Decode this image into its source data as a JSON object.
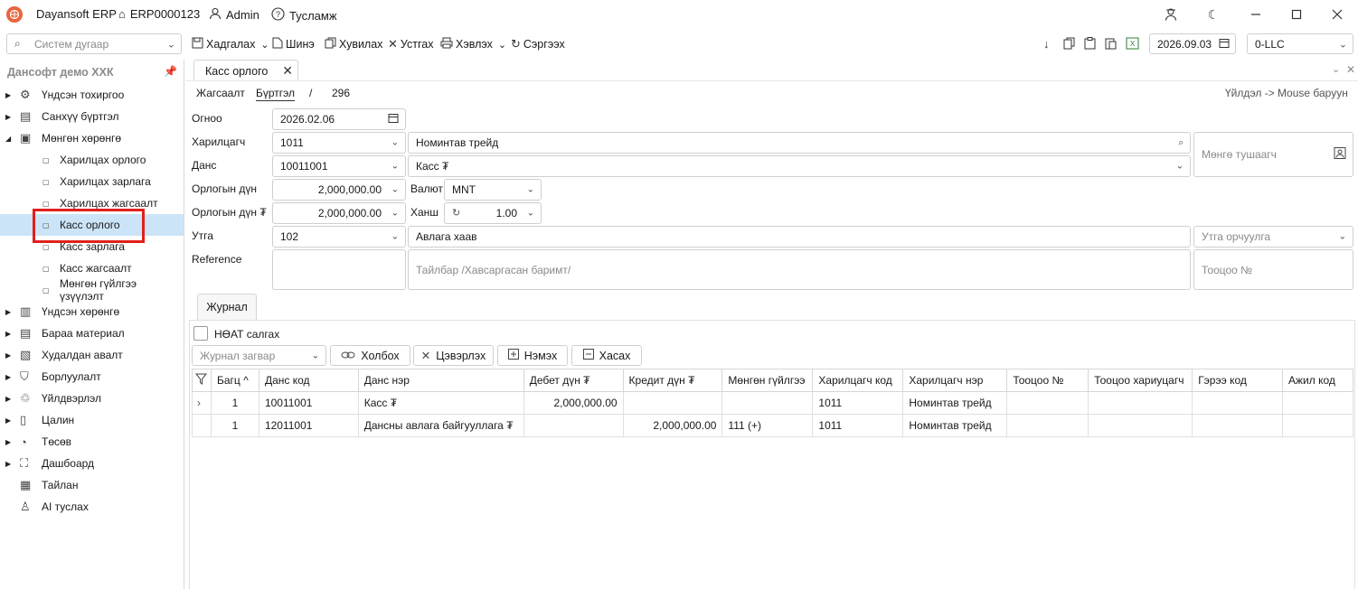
{
  "titlebar": {
    "app_name": "Dayansoft ERP",
    "db_name": "ERP0000123",
    "user": "Admin",
    "help": "Тусламж"
  },
  "toolbar": {
    "system_search_placeholder": "Систем дугаар",
    "save": "Хадгалах",
    "new": "Шинэ",
    "copy": "Хувилах",
    "delete": "Устгах",
    "print": "Хэвлэх",
    "refresh": "Сэргээх",
    "date": "2026.09.03",
    "company": "0-LLC"
  },
  "sidebar": {
    "company": "Дансофт демо ХХК",
    "items": [
      {
        "label": "Үндсэн тохиргоо",
        "icon": "gear-icon"
      },
      {
        "label": "Санхүү бүртгэл",
        "icon": "ledger-icon"
      },
      {
        "label": "Мөнгөн хөрөнгө",
        "icon": "cash-icon"
      },
      {
        "label": "Харилцах орлого",
        "icon": "bullet-icon"
      },
      {
        "label": "Харилцах зарлага",
        "icon": "bullet-icon"
      },
      {
        "label": "Харилцах жагсаалт",
        "icon": "bullet-icon"
      },
      {
        "label": "Касс орлого",
        "icon": "bullet-icon"
      },
      {
        "label": "Касс зарлага",
        "icon": "bullet-icon"
      },
      {
        "label": "Касс жагсаалт",
        "icon": "bullet-icon"
      },
      {
        "label": "Мөнгөн гүйлгээ үзүүлэлт",
        "icon": "bullet-icon"
      },
      {
        "label": "Үндсэн хөрөнгө",
        "icon": "building-icon"
      },
      {
        "label": "Бараа материал",
        "icon": "box-icon"
      },
      {
        "label": "Худалдан авалт",
        "icon": "cart-icon"
      },
      {
        "label": "Борлуулалт",
        "icon": "sales-icon"
      },
      {
        "label": "Үйлдвэрлэл",
        "icon": "factory-icon"
      },
      {
        "label": "Цалин",
        "icon": "payroll-icon"
      },
      {
        "label": "Төсөв",
        "icon": "pie-icon"
      },
      {
        "label": "Дашбоард",
        "icon": "dashboard-icon"
      },
      {
        "label": "Тайлан",
        "icon": "report-icon"
      },
      {
        "label": "AI туслах",
        "icon": "ai-icon"
      }
    ]
  },
  "doc_tab": {
    "label": "Касс орлого"
  },
  "breadcrumb": {
    "list": "Жагсаалт",
    "register": "Бүртгэл",
    "sep": "/",
    "number": "296"
  },
  "hint": "Үйлдэл -> Mouse баруун",
  "form": {
    "date_label": "Огноо",
    "date": "2026.02.06",
    "partner_label": "Харилцагч",
    "partner_code": "1011",
    "partner_name": "Номинтав трейд",
    "cash_receiver": "Мөнгө тушаагч",
    "account_label": "Данс",
    "account_code": "10011001",
    "account_name": "Касс ₮",
    "amount_label": "Орлогын дүн",
    "amount": "2,000,000.00",
    "currency_label": "Валют",
    "currency": "MNT",
    "amount_mnt_label": "Орлогын дүн ₮",
    "amount_mnt": "2,000,000.00",
    "rate_label": "Ханш",
    "rate": "1.00",
    "purpose_label": "Утга",
    "purpose_code": "102",
    "purpose_text": "Авлага хаав",
    "purpose_translate": "Утга орчуулга",
    "reference_label": "Reference",
    "note_placeholder": "Тайлбар /Хавсаргасан баримт/",
    "count_placeholder": "Тооцоо №"
  },
  "journal": {
    "tab": "Журнал",
    "vat_checkbox": "НӨАТ салгах",
    "template_placeholder": "Журнал загвар",
    "link": "Холбох",
    "clear": "Цэвэрлэх",
    "add": "Нэмэх",
    "remove": "Хасах",
    "columns": [
      "Багц",
      "Данс код",
      "Данс нэр",
      "Дебет дүн ₮",
      "Кредит дүн ₮",
      "Мөнгөн гүйлгээ",
      "Харилцагч код",
      "Харилцагч нэр",
      "Тооцоо №",
      "Тооцоо хариуцагч",
      "Гэрээ код",
      "Ажил код"
    ],
    "rows": [
      {
        "pointer": "›",
        "batch": "1",
        "acc_code": "10011001",
        "acc_name": "Касс ₮",
        "debit": "2,000,000.00",
        "credit": "",
        "cashflow": "",
        "partner_code": "1011",
        "partner_name": "Номинтав трейд"
      },
      {
        "pointer": "",
        "batch": "1",
        "acc_code": "12011001",
        "acc_name": "Дансны авлага байгууллага ₮",
        "debit": "",
        "credit": "2,000,000.00",
        "cashflow": "111 (+)",
        "partner_code": "1011",
        "partner_name": "Номинтав трейд"
      }
    ]
  },
  "colors": {
    "accent": "#e8643c",
    "selection": "#cce4f7",
    "highlight": "#e0201b"
  }
}
